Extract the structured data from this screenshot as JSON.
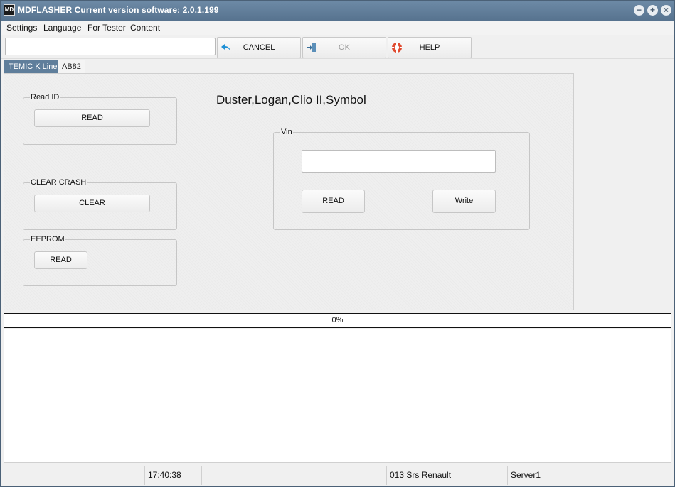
{
  "window": {
    "title": "MDFLASHER  Current version software: 2.0.1.199",
    "icon_text": "MD"
  },
  "menu": [
    "Settings",
    "Language",
    "For Tester",
    "Content"
  ],
  "toolbar": {
    "input_value": "",
    "cancel_label": "CANCEL",
    "ok_label": "OK",
    "help_label": "HELP"
  },
  "tabs": [
    {
      "label": "TEMIC K Line",
      "active": true
    },
    {
      "label": "AB82",
      "active": false
    }
  ],
  "panel": {
    "vehicles": "Duster,Logan,Clio II,Symbol",
    "read_id": {
      "title": "Read ID",
      "button": "READ"
    },
    "clear_crash": {
      "title": "CLEAR CRASH",
      "button": "CLEAR"
    },
    "eeprom": {
      "title": "EEPROM",
      "button": "READ"
    },
    "vin": {
      "title": "Vin",
      "value": "",
      "read_button": "READ",
      "write_button": "Write"
    }
  },
  "progress": {
    "text": "0%",
    "percent": 0
  },
  "status": {
    "cell1": "",
    "time": "17:40:38",
    "cell3": "",
    "cell4": "",
    "module": "013 Srs Renault",
    "server": "Server1"
  },
  "colors": {
    "titlebar": "#5f7e9b",
    "active_tab": "#5f7e9b",
    "cancel_icon": "#1e90d6",
    "help_icon": "#e04a2f"
  }
}
